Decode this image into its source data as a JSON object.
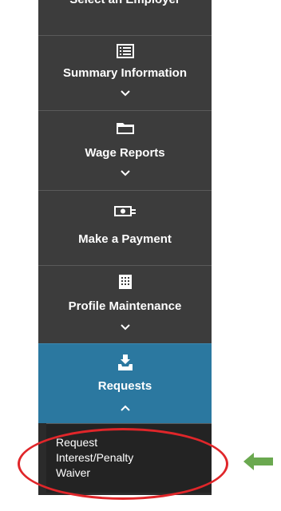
{
  "nav": {
    "partial_label": "Select an Employer",
    "items": [
      {
        "label": "Summary Information",
        "icon": "list-icon",
        "expanded": false
      },
      {
        "label": "Wage Reports",
        "icon": "folder-icon",
        "expanded": false
      },
      {
        "label": "Make a Payment",
        "icon": "money-icon",
        "expanded": false
      },
      {
        "label": "Profile Maintenance",
        "icon": "building-icon",
        "expanded": false
      },
      {
        "label": "Requests",
        "icon": "inbox-icon",
        "expanded": true
      }
    ],
    "submenu": {
      "link_label": "Request\nInterest/Penalty\nWaiver"
    }
  },
  "colors": {
    "nav_bg": "#3c3c3c",
    "active_bg": "#2b78a0",
    "submenu_bg": "#232323",
    "highlight": "#e0262a",
    "arrow": "#6aa84f"
  }
}
